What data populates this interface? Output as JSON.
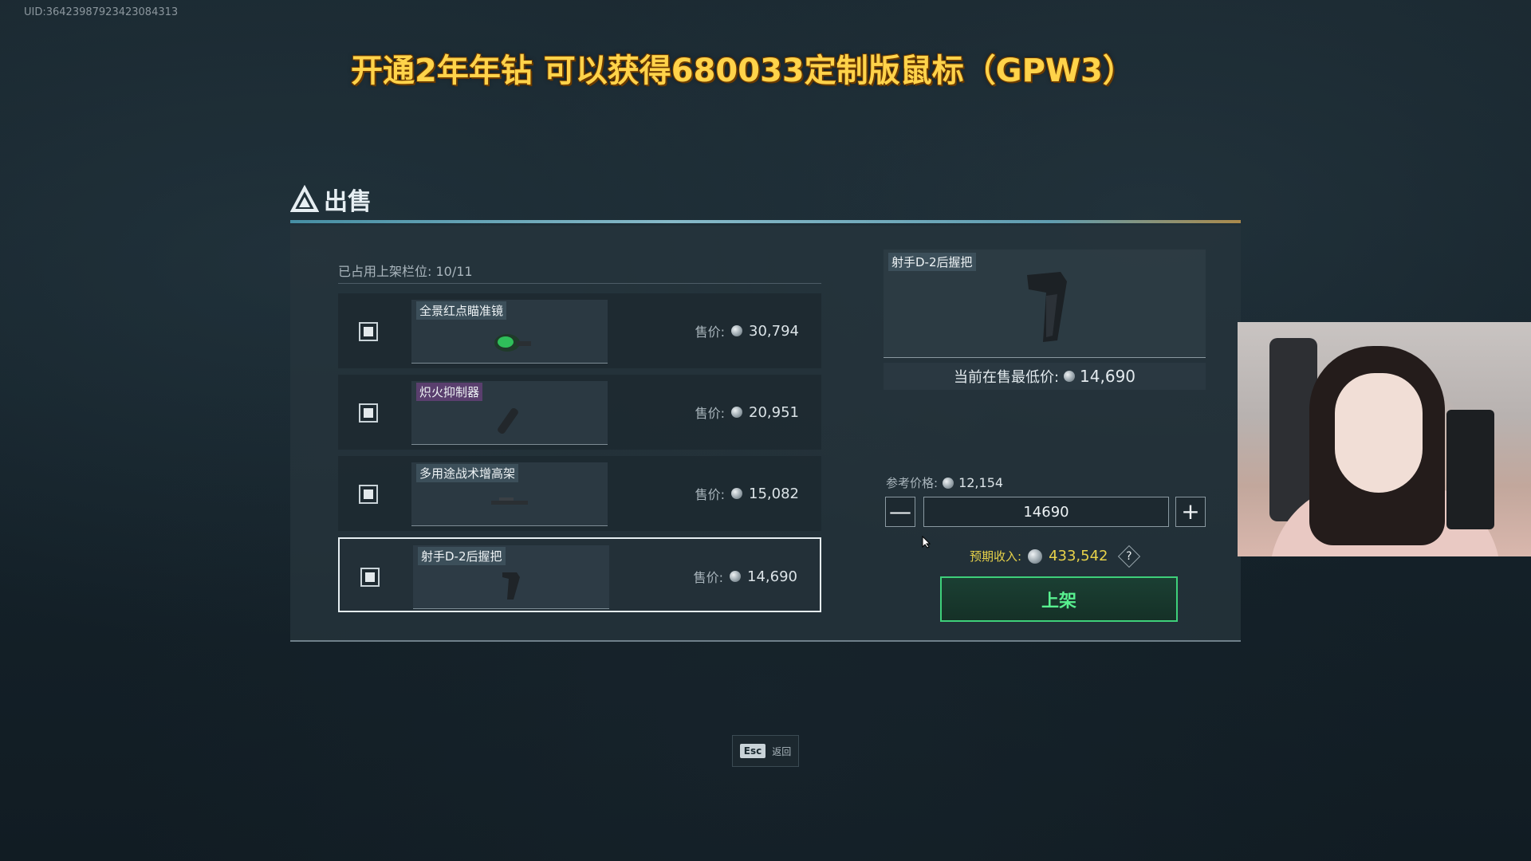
{
  "uid": "UID:36423987923423084313",
  "banner": "开通2年年钻 可以获得680033定制版鼠标（GPW3）",
  "header": {
    "title": "出售"
  },
  "slots": {
    "label": "已占用上架栏位: 10/11"
  },
  "items": [
    {
      "name": "全景红点瞄准镜",
      "price_label": "售价:",
      "price": "30,794",
      "name_color": "#3c4f5a"
    },
    {
      "name": "炽火抑制器",
      "price_label": "售价:",
      "price": "20,951",
      "name_color": "#5a3f6e"
    },
    {
      "name": "多用途战术增高架",
      "price_label": "售价:",
      "price": "15,082",
      "name_color": "#3c4f5a"
    },
    {
      "name": "射手D-2后握把",
      "price_label": "售价:",
      "price": "14,690",
      "name_color": "#3c4f5a"
    }
  ],
  "preview": {
    "name": "射手D-2后握把",
    "lowest_label": "当前在售最低价:",
    "lowest_value": "14,690"
  },
  "reference": {
    "label": "参考价格:",
    "value": "12,154"
  },
  "stepper": {
    "value": "14690",
    "minus": "—",
    "plus": "+"
  },
  "income": {
    "label": "预期收入:",
    "value": "433,542",
    "help": "?"
  },
  "list_button": "上架",
  "esc": {
    "key": "Esc",
    "label": "返回"
  },
  "colors": {
    "accent_green": "#3ed07a",
    "income_yellow": "#e7d24a",
    "banner_yellow": "#ffd34a"
  },
  "icons": [
    "sell-logo-icon",
    "coin-icon",
    "minus-icon",
    "plus-icon",
    "help-icon",
    "cursor-icon"
  ]
}
